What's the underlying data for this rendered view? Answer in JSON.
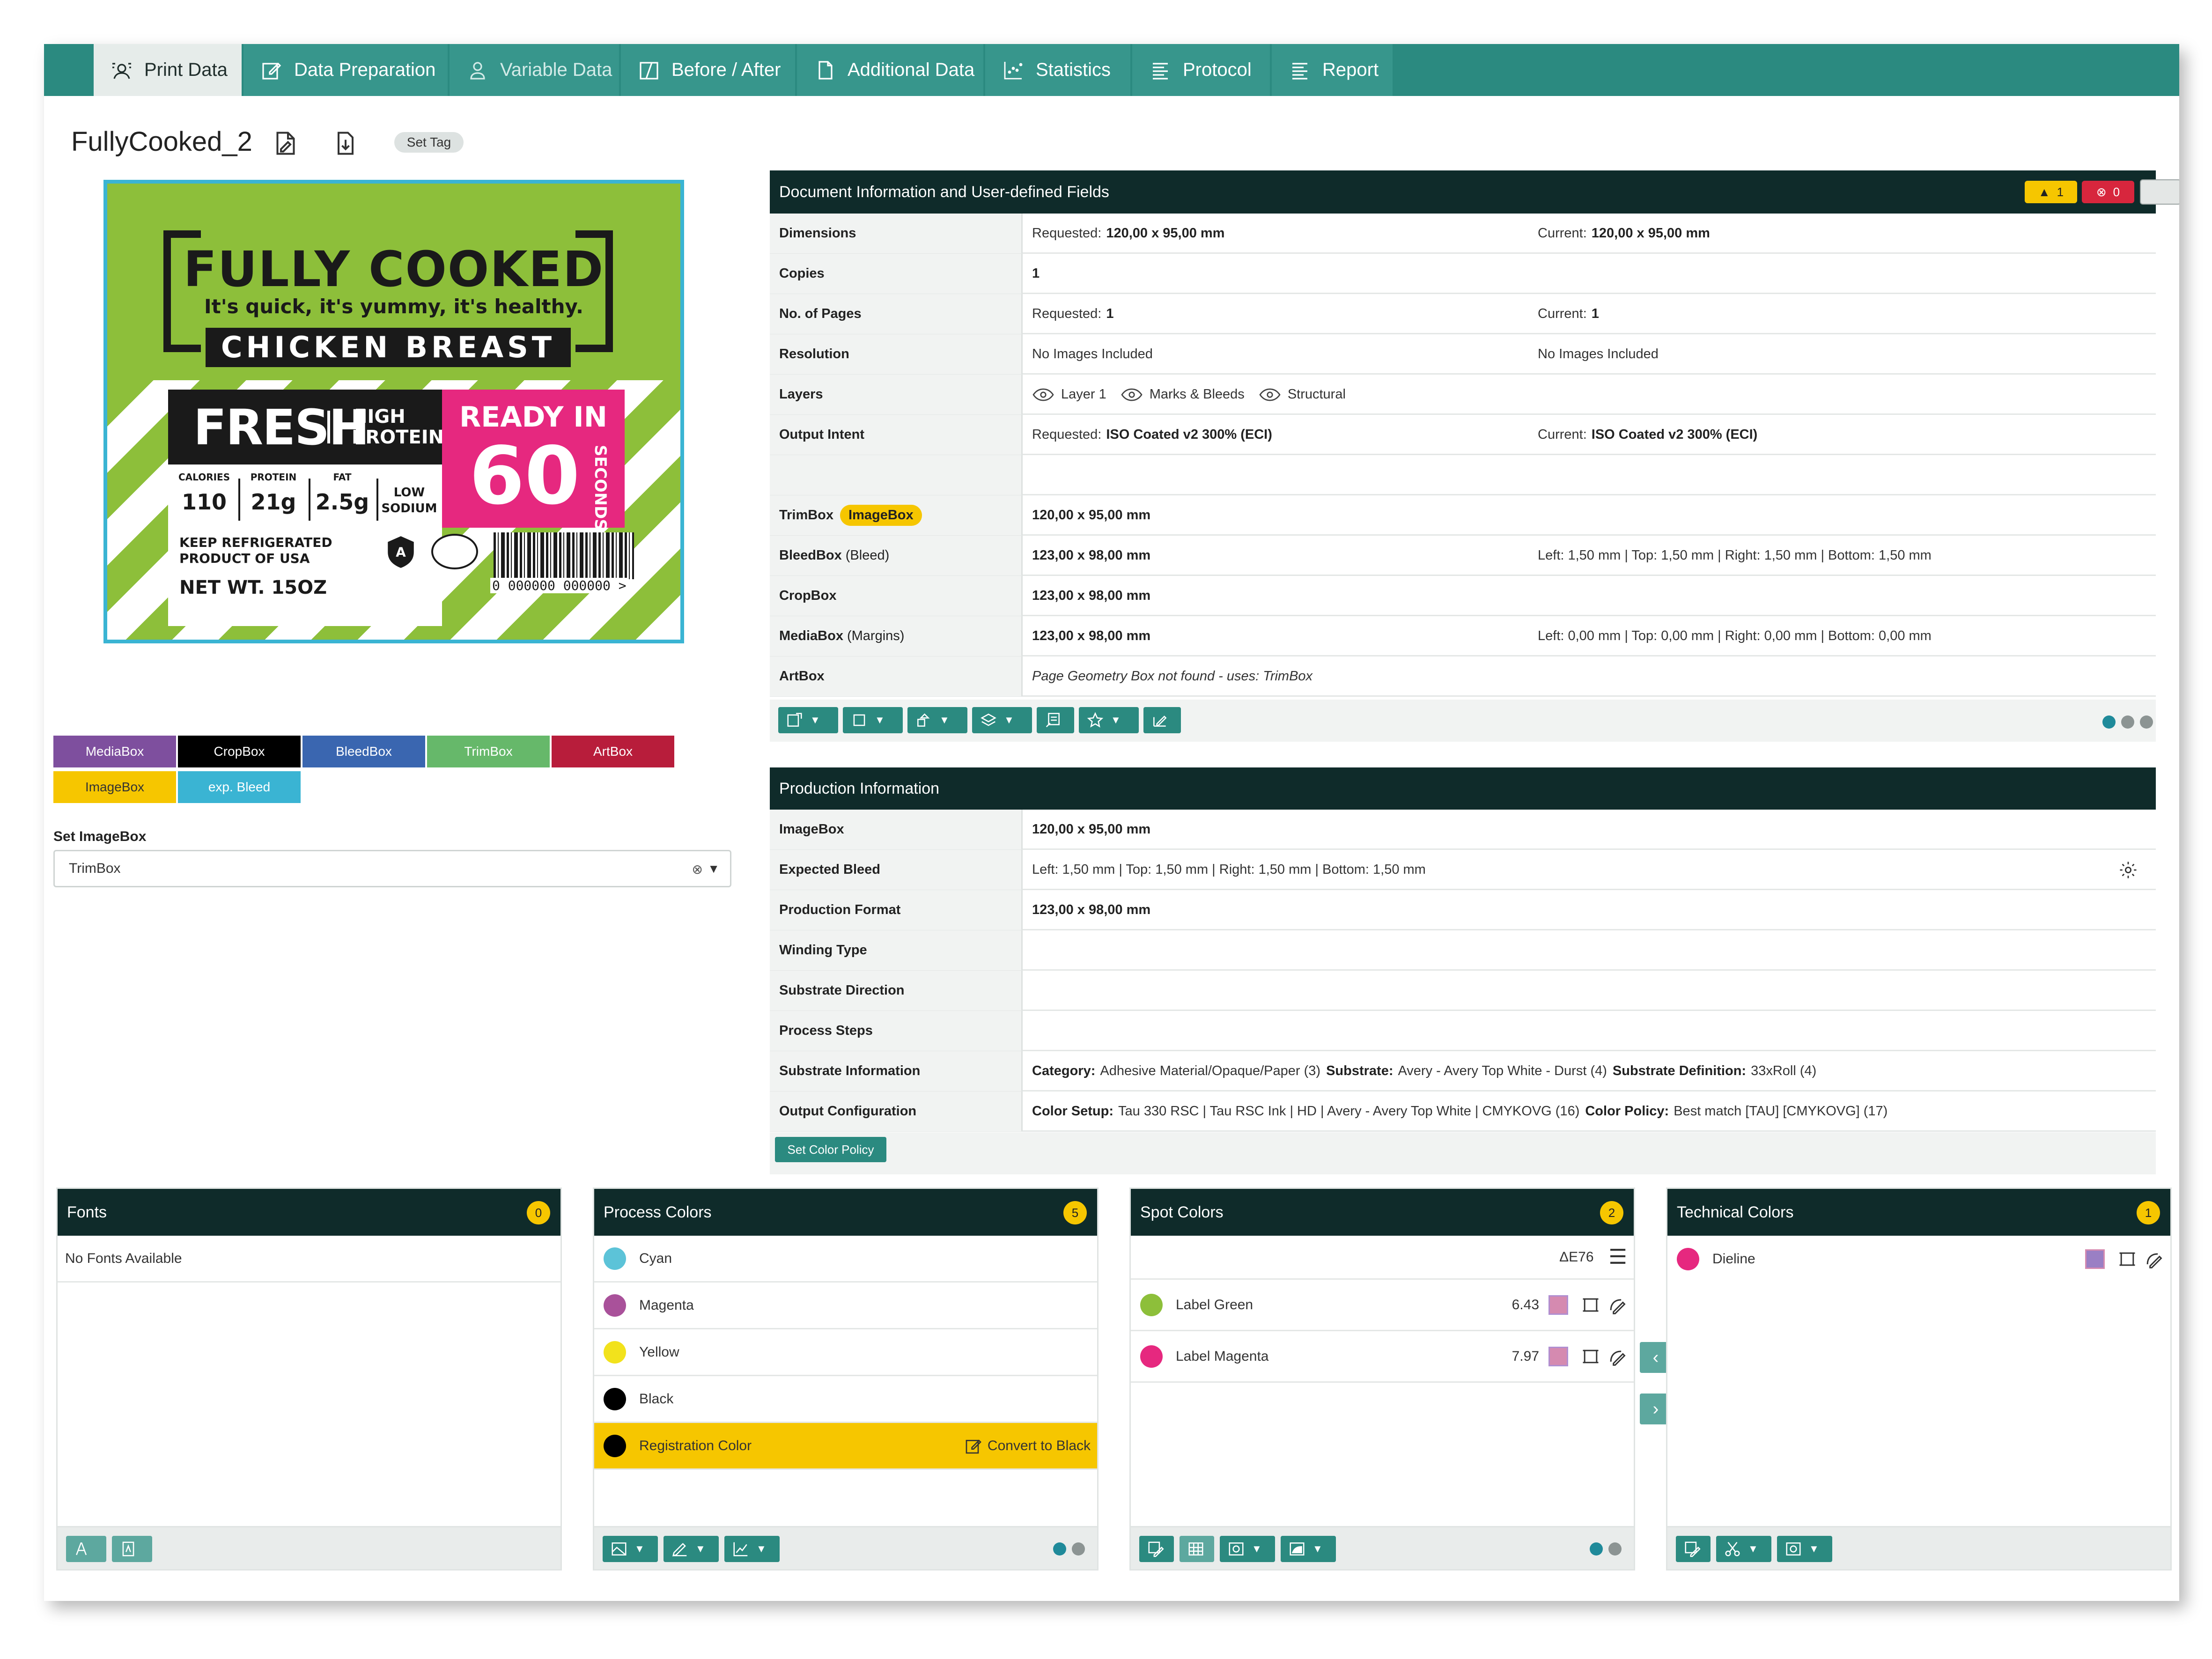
{
  "tabs": [
    {
      "label": "Print Data",
      "icon": "print-data-icon",
      "active": true
    },
    {
      "label": "Data Preparation",
      "icon": "edit-icon"
    },
    {
      "label": "Variable Data",
      "icon": "variable-data-icon"
    },
    {
      "label": "Before / After",
      "icon": "before-after-icon"
    },
    {
      "label": "Additional Data",
      "icon": "additional-data-icon"
    },
    {
      "label": "Statistics",
      "icon": "statistics-icon"
    },
    {
      "label": "Protocol",
      "icon": "protocol-icon"
    },
    {
      "label": "Report",
      "icon": "report-icon"
    }
  ],
  "document": {
    "title": "FullyCooked_2",
    "set_tag_label": "Set Tag"
  },
  "label_artwork": {
    "title": "FULLY COOKED",
    "tagline": "It's quick, it's yummy, it's healthy.",
    "product": "CHICKEN BREAST",
    "fresh": "FRESH",
    "high": "HIGH",
    "protein_word": "PROTEIN",
    "calories_label": "CALORIES",
    "calories": "110",
    "protein_label": "PROTEIN",
    "protein": "21g",
    "fat_label": "FAT",
    "fat": "2.5g",
    "low": "LOW",
    "sodium": "SODIUM",
    "keep1": "KEEP REFRIGERATED",
    "keep2": "PRODUCT OF USA",
    "net": "NET WT. 15OZ",
    "ready": "READY IN",
    "ready_num": "60",
    "ready_unit": "SECONDS",
    "grade": "A",
    "barcode_digits": "0 000000 000000 >"
  },
  "legend": [
    {
      "label": "MediaBox",
      "color": "#7e4f9e"
    },
    {
      "label": "CropBox",
      "color": "#000000"
    },
    {
      "label": "BleedBox",
      "color": "#3a66b0"
    },
    {
      "label": "TrimBox",
      "color": "#66b86a"
    },
    {
      "label": "ArtBox",
      "color": "#b81d3b"
    },
    {
      "label": "ImageBox",
      "color": "#f6c600"
    },
    {
      "label": "exp. Bleed",
      "color": "#3ab4d3"
    }
  ],
  "imagebox_select": {
    "label": "Set ImageBox",
    "value": "TrimBox"
  },
  "doc_info": {
    "header": "Document Information and User-defined Fields",
    "warnings": "1",
    "errors": "0",
    "rows": {
      "dimensions": {
        "label": "Dimensions",
        "req_key": "Requested:",
        "req": "120,00 x 95,00 mm",
        "cur_key": "Current:",
        "cur": "120,00 x 95,00 mm"
      },
      "copies": {
        "label": "Copies",
        "value": "1"
      },
      "pages": {
        "label": "No. of Pages",
        "req_key": "Requested:",
        "req": "1",
        "cur_key": "Current:",
        "cur": "1"
      },
      "resolution": {
        "label": "Resolution",
        "req": "No Images Included",
        "cur": "No Images Included"
      },
      "layers": {
        "label": "Layers",
        "items": [
          "Layer 1",
          "Marks & Bleeds",
          "Structural"
        ]
      },
      "output_intent": {
        "label": "Output Intent",
        "req_key": "Requested:",
        "req": "ISO Coated v2 300% (ECI)",
        "cur_key": "Current:",
        "cur": "ISO Coated v2 300% (ECI)"
      },
      "trimbox": {
        "label": "TrimBox",
        "pill": "ImageBox",
        "value": "120,00 x 95,00 mm"
      },
      "bleedbox": {
        "label": "BleedBox",
        "extra": "(Bleed)",
        "value": "123,00 x 98,00 mm",
        "detail": "Left: 1,50 mm | Top: 1,50 mm | Right: 1,50 mm | Bottom: 1,50 mm"
      },
      "cropbox": {
        "label": "CropBox",
        "value": "123,00 x 98,00 mm"
      },
      "mediabox": {
        "label": "MediaBox",
        "extra": "(Margins)",
        "value": "123,00 x 98,00 mm",
        "detail": "Left: 0,00 mm | Top: 0,00 mm | Right: 0,00 mm | Bottom: 0,00 mm"
      },
      "artbox": {
        "label": "ArtBox",
        "value": "Page Geometry Box not found - uses: TrimBox"
      }
    }
  },
  "production_info": {
    "header": "Production Information",
    "rows": {
      "imagebox": {
        "label": "ImageBox",
        "value": "120,00 x 95,00 mm"
      },
      "expected_bleed": {
        "label": "Expected Bleed",
        "value": "Left: 1,50 mm | Top: 1,50 mm | Right: 1,50 mm | Bottom: 1,50 mm"
      },
      "production_format": {
        "label": "Production Format",
        "value": "123,00 x 98,00 mm"
      },
      "winding_type": {
        "label": "Winding Type"
      },
      "substrate_direction": {
        "label": "Substrate Direction"
      },
      "process_steps": {
        "label": "Process Steps"
      },
      "substrate_info": {
        "label": "Substrate Information",
        "k1": "Category:",
        "v1": "Adhesive Material/Opaque/Paper (3)",
        "k2": "Substrate:",
        "v2": "Avery - Avery Top White - Durst (4)",
        "k3": "Substrate Definition:",
        "v3": "33xRoll (4)"
      },
      "output_config": {
        "label": "Output Configuration",
        "k1": "Color Setup:",
        "v1": "Tau 330 RSC | Tau RSC Ink | HD | Avery - Avery Top White | CMYKOVG (16)",
        "k2": "Color Policy:",
        "v2": "Best match [TAU] [CMYKOVG] (17)"
      }
    },
    "set_color_policy": "Set Color Policy"
  },
  "fonts_panel": {
    "title": "Fonts",
    "count": "0",
    "empty": "No Fonts Available"
  },
  "process_panel": {
    "title": "Process Colors",
    "count": "5",
    "colors": [
      {
        "name": "Cyan",
        "color": "#5cc3d8"
      },
      {
        "name": "Magenta",
        "color": "#a9519a"
      },
      {
        "name": "Yellow",
        "color": "#f2e21c"
      },
      {
        "name": "Black",
        "color": "#000000"
      },
      {
        "name": "Registration Color",
        "color": "#000000"
      }
    ],
    "convert_label": "Convert to Black"
  },
  "spot_panel": {
    "title": "Spot Colors",
    "count": "2",
    "delta_label": "ΔE76",
    "colors": [
      {
        "name": "Label Green",
        "value": "6.43",
        "color": "#8dbf3a"
      },
      {
        "name": "Label Magenta",
        "value": "7.97",
        "color": "#e6287f"
      }
    ]
  },
  "technical_panel": {
    "title": "Technical Colors",
    "count": "1",
    "colors": [
      {
        "name": "Dieline",
        "color": "#e6287f"
      }
    ]
  },
  "nav_arrows": {
    "left": "‹",
    "right": "›"
  }
}
